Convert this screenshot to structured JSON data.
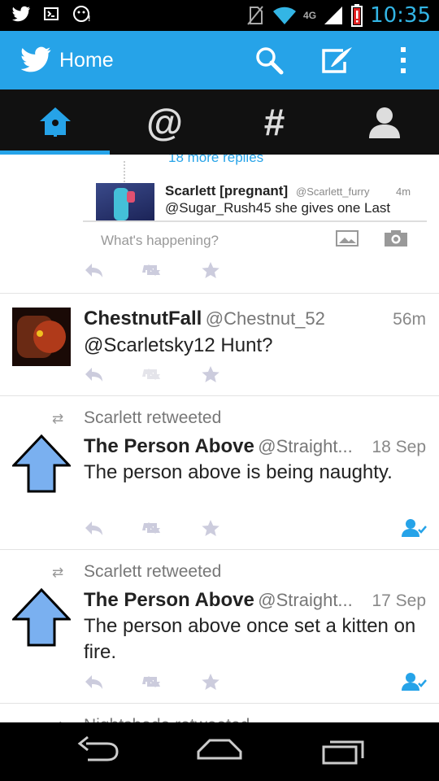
{
  "status": {
    "time": "10:35",
    "network": "4G"
  },
  "header": {
    "title": "Home"
  },
  "tabs": [
    "home",
    "mentions",
    "discover",
    "me"
  ],
  "conversation": {
    "more_replies": "18 more replies",
    "reply_name": "Scarlett [pregnant]",
    "reply_handle": "@Scarlett_furry",
    "reply_time": "4m",
    "reply_text": "@Sugar_Rush45 she gives one Last",
    "compose_placeholder": "What's happening?"
  },
  "tweets": [
    {
      "name": "ChestnutFall",
      "handle": "@Chestnut_52",
      "time": "56m",
      "text": "@Scarletsky12 Hunt?"
    },
    {
      "retweeter": "Scarlett",
      "retweeted_label": "retweeted",
      "name": "The Person Above",
      "handle": "@Straight...",
      "time": "18 Sep",
      "text": "The person above is being naughty."
    },
    {
      "retweeter": "Scarlett",
      "retweeted_label": "retweeted",
      "name": "The Person Above",
      "handle": "@Straight...",
      "time": "17 Sep",
      "text": "The person above once set a kitten on fire."
    }
  ],
  "partial_next": "Nightshade retweeted"
}
